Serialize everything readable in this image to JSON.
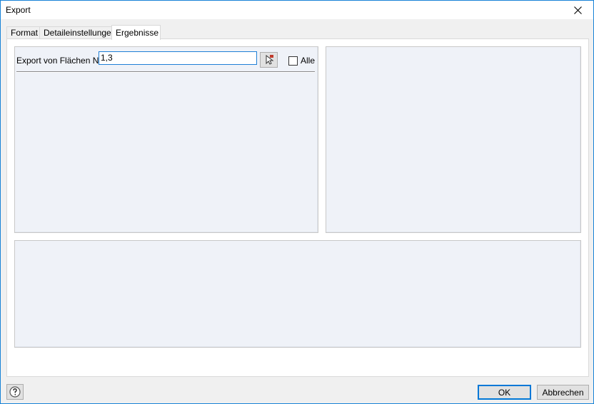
{
  "window": {
    "title": "Export"
  },
  "tabs": [
    {
      "label": "Format",
      "active": false
    },
    {
      "label": "Detaileinstellungen",
      "active": false
    },
    {
      "label": "Ergebnisse",
      "active": true
    }
  ],
  "export_areas": {
    "label": "Export von Flächen Nr.:",
    "value": "1,3",
    "all_checkbox": {
      "label": "Alle",
      "checked": false
    }
  },
  "footer": {
    "ok_label": "OK",
    "cancel_label": "Abbrechen"
  },
  "colors": {
    "accent": "#0078d7",
    "panel_bg": "#eff2f8"
  }
}
